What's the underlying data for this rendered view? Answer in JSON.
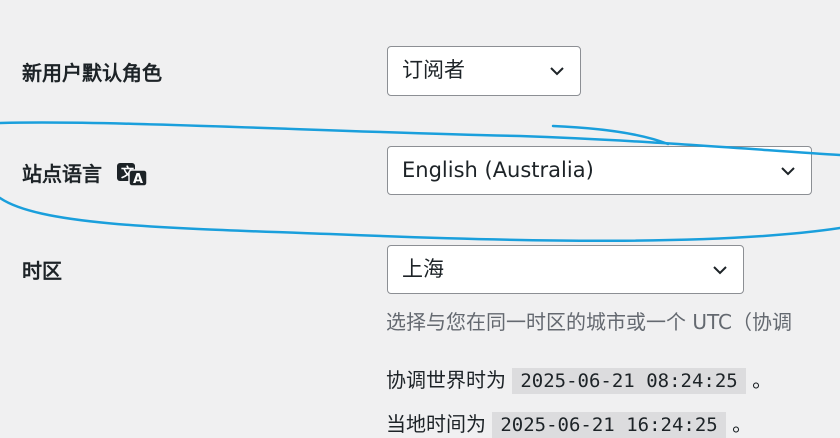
{
  "settings": {
    "default_role": {
      "label": "新用户默认角色",
      "value": "订阅者"
    },
    "site_language": {
      "label": "站点语言",
      "value": "English (Australia)",
      "icon": "translation-icon"
    },
    "timezone": {
      "label": "时区",
      "value": "上海",
      "description": "选择与您在同一时区的城市或一个 UTC（协调",
      "utc_prefix": "协调世界时为",
      "utc_time": "2025-06-21 08:24:25",
      "utc_suffix": "。",
      "local_prefix": "当地时间为",
      "local_time": "2025-06-21 16:24:25",
      "local_suffix": "。"
    }
  },
  "colors": {
    "annotation": "#1a9fdc",
    "border": "#8c8f94",
    "text": "#1d2327",
    "muted": "#646970"
  }
}
